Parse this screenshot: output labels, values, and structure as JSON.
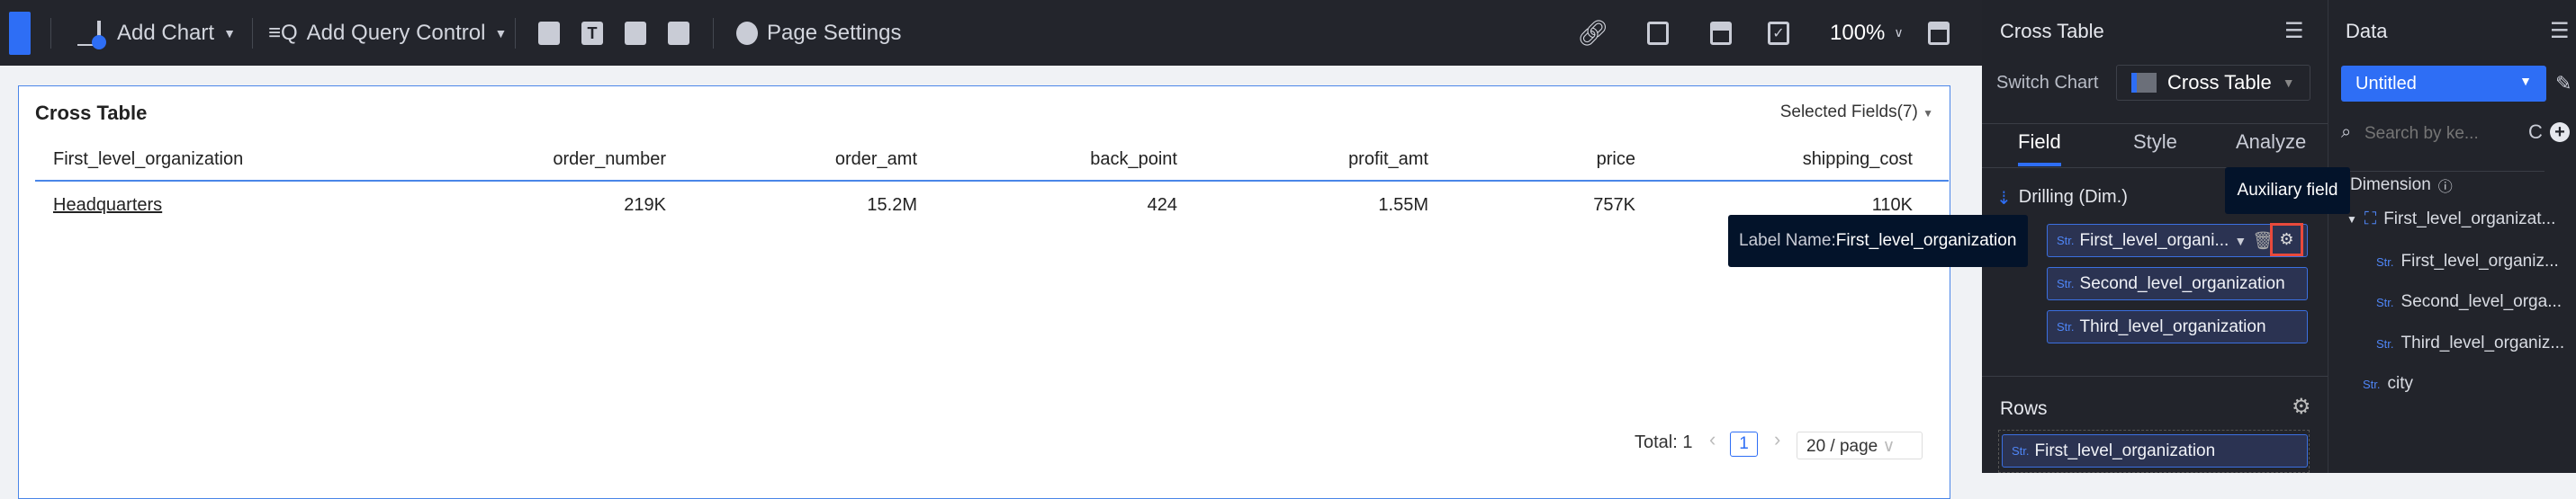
{
  "toolbar": {
    "add_chart": "Add Chart",
    "add_query_control": "Add Query Control",
    "page_settings": "Page Settings",
    "zoom": "100%"
  },
  "card": {
    "title": "Cross Table",
    "selected_fields": "Selected Fields(7)",
    "columns": [
      "First_level_organization",
      "order_number",
      "order_amt",
      "back_point",
      "profit_amt",
      "price",
      "shipping_cost"
    ],
    "rows": [
      [
        "Headquarters",
        "219K",
        "15.2M",
        "424",
        "1.55M",
        "757K",
        "110K"
      ]
    ],
    "pagination": {
      "total": "Total: 1",
      "page": "1",
      "page_size": "20 / page"
    }
  },
  "panel": {
    "title": "Cross Table",
    "switch_chart_label": "Switch Chart",
    "chart_type": "Cross Table",
    "tabs": [
      "Field",
      "Style",
      "Analyze"
    ],
    "active_tab": "Field",
    "drilling_label": "Drilling (Dim.)",
    "drill_fields": [
      "First_level_organi...",
      "Second_level_organization",
      "Third_level_organization"
    ],
    "rows_label": "Rows",
    "rows_field": "First_level_organization",
    "str": "Str."
  },
  "tooltips": {
    "label_name_prefix": "Label Name:",
    "label_name_value": "First_level_organization",
    "auxiliary": "Auxiliary field"
  },
  "data": {
    "title": "Data",
    "dataset": "Untitled",
    "search_placeholder": "Search by ke...",
    "dimension_label": "Dimension",
    "tree": {
      "group": "First_level_organizat...",
      "children": [
        "First_level_organiz...",
        "Second_level_orga...",
        "Third_level_organiz..."
      ],
      "city": "city"
    }
  },
  "colors": {
    "accent": "#2e6ef5",
    "highlight": "#e84a3c"
  }
}
